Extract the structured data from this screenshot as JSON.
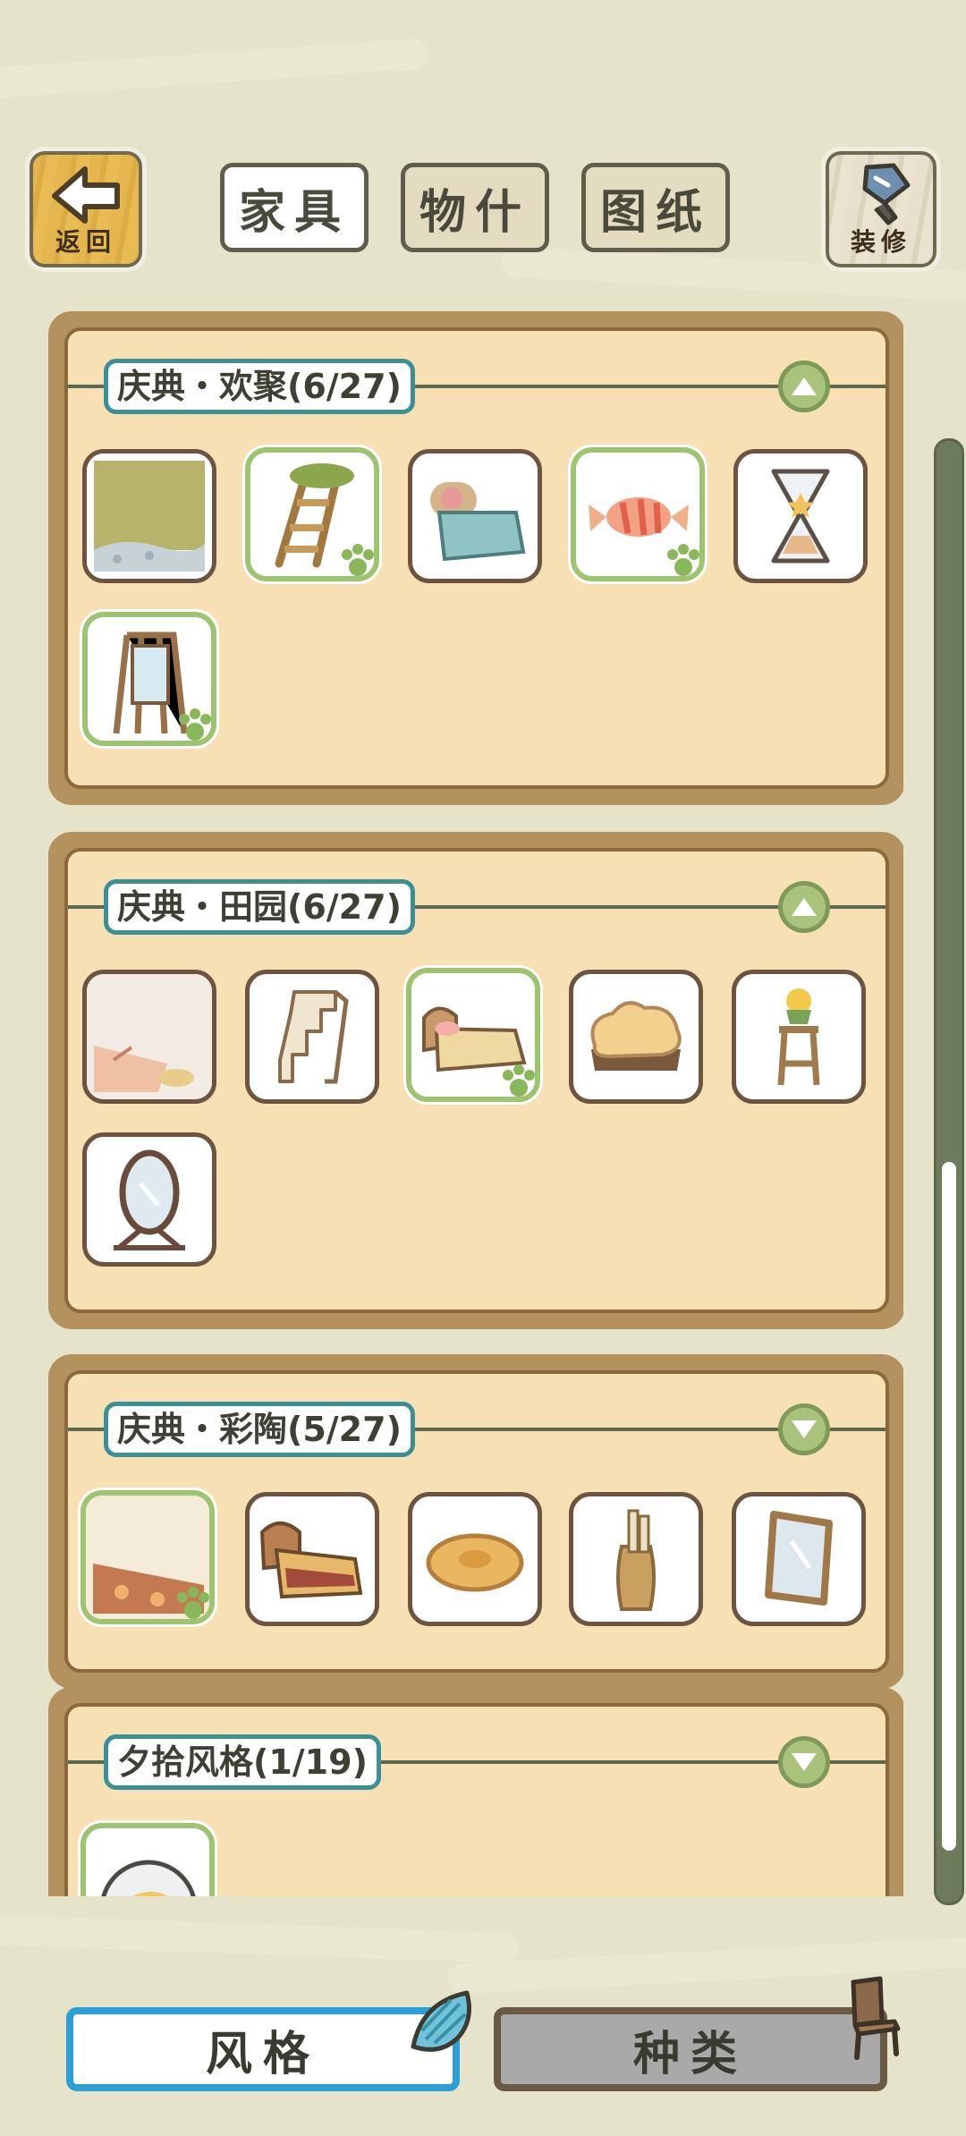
{
  "header": {
    "back_label": "返回",
    "decor_label": "装修",
    "tabs": [
      {
        "label": "家具",
        "active": true
      },
      {
        "label": "物什",
        "active": false
      },
      {
        "label": "图纸",
        "active": false
      }
    ]
  },
  "sections": [
    {
      "title": "庆典・欢聚(6/27)",
      "expanded": true,
      "items": [
        {
          "icon": "green-wallpaper-icon",
          "owned": false
        },
        {
          "icon": "mossy-ladder-icon",
          "owned": true
        },
        {
          "icon": "flower-bed-icon",
          "owned": false
        },
        {
          "icon": "striped-candy-icon",
          "owned": true
        },
        {
          "icon": "star-hourglass-icon",
          "owned": false
        },
        {
          "icon": "easel-mirror-icon",
          "owned": true
        }
      ]
    },
    {
      "title": "庆典・田园(6/27)",
      "expanded": true,
      "items": [
        {
          "icon": "rustic-floor-icon",
          "owned": false
        },
        {
          "icon": "wooden-stairs-icon",
          "owned": false
        },
        {
          "icon": "country-bed-icon",
          "owned": true
        },
        {
          "icon": "bread-cushion-icon",
          "owned": false
        },
        {
          "icon": "flower-stool-icon",
          "owned": false
        },
        {
          "icon": "standing-mirror-icon",
          "owned": false
        }
      ]
    },
    {
      "title": "庆典・彩陶(5/27)",
      "expanded": false,
      "items": [
        {
          "icon": "pottery-floor-icon",
          "owned": true
        },
        {
          "icon": "ornate-bed-icon",
          "owned": false
        },
        {
          "icon": "round-cushion-icon",
          "owned": false
        },
        {
          "icon": "scroll-vase-icon",
          "owned": false
        },
        {
          "icon": "floor-mirror-icon",
          "owned": false
        }
      ]
    },
    {
      "title": "夕拾风格(1/19)",
      "expanded": false,
      "items": [
        {
          "icon": "moon-orb-icon",
          "owned": true
        }
      ]
    }
  ],
  "footer": {
    "style_label": "风格",
    "type_label": "种类"
  },
  "colors": {
    "background": "#e6e3cb",
    "card_frame": "#b49260",
    "card_fill": "#f7e0b4",
    "owned_border": "#9ec472",
    "title_border": "#3d8f96",
    "active_bottom": "#2c9fd4",
    "inactive_bottom": "#a9a9a9"
  }
}
